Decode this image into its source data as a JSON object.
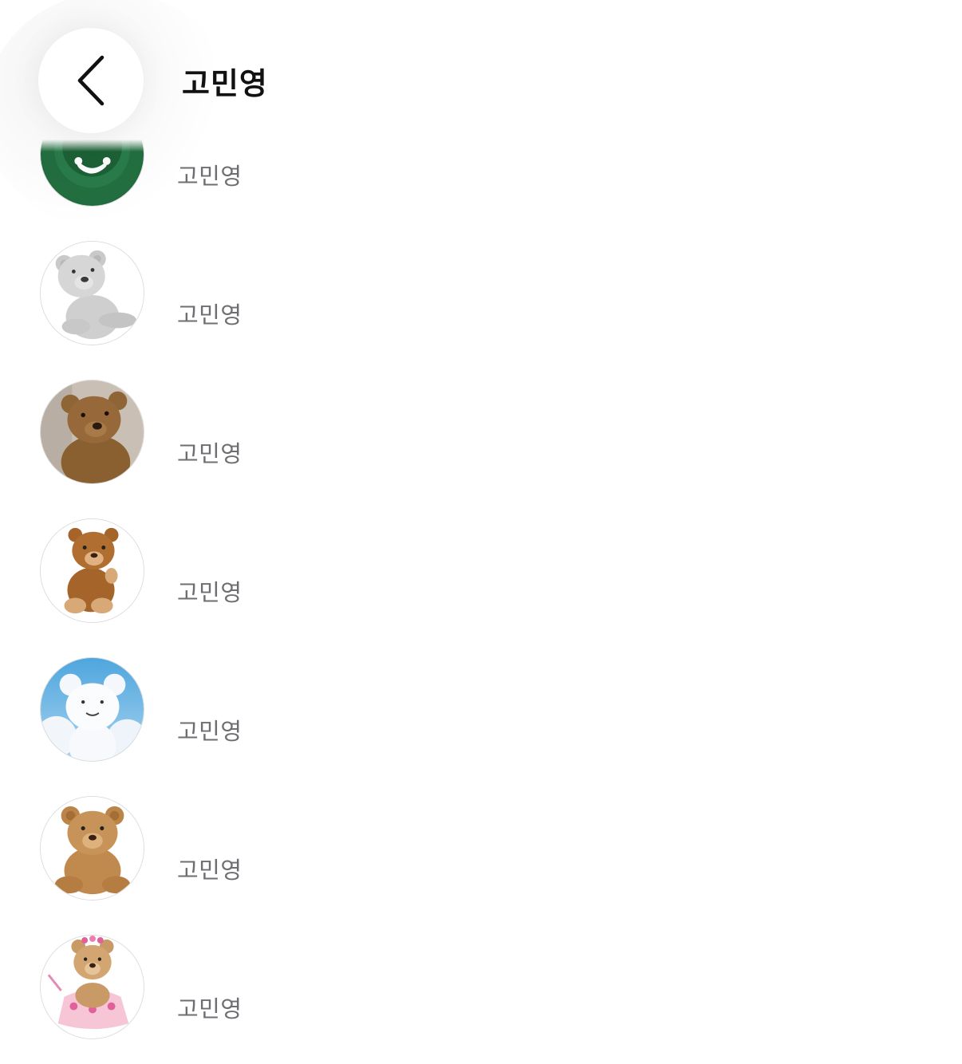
{
  "header": {
    "title": "고민영",
    "back_icon": "chevron-left-icon"
  },
  "rows": [
    {
      "name": "고민영",
      "avatar": "green-button-avatar"
    },
    {
      "name": "고민영",
      "avatar": "gray-teddy-bear-avatar"
    },
    {
      "name": "고민영",
      "avatar": "brown-teddy-bear-photo-avatar"
    },
    {
      "name": "고민영",
      "avatar": "brown-teddy-bear-avatar"
    },
    {
      "name": "고민영",
      "avatar": "cloud-bear-avatar"
    },
    {
      "name": "고민영",
      "avatar": "tan-teddy-bear-avatar"
    },
    {
      "name": "고민영",
      "avatar": "ballerina-teddy-bear-avatar"
    }
  ],
  "colors": {
    "title": "#111111",
    "name": "#6d6d72",
    "avatar_border": "#dcdcdc",
    "green": "#1f6b3c"
  }
}
